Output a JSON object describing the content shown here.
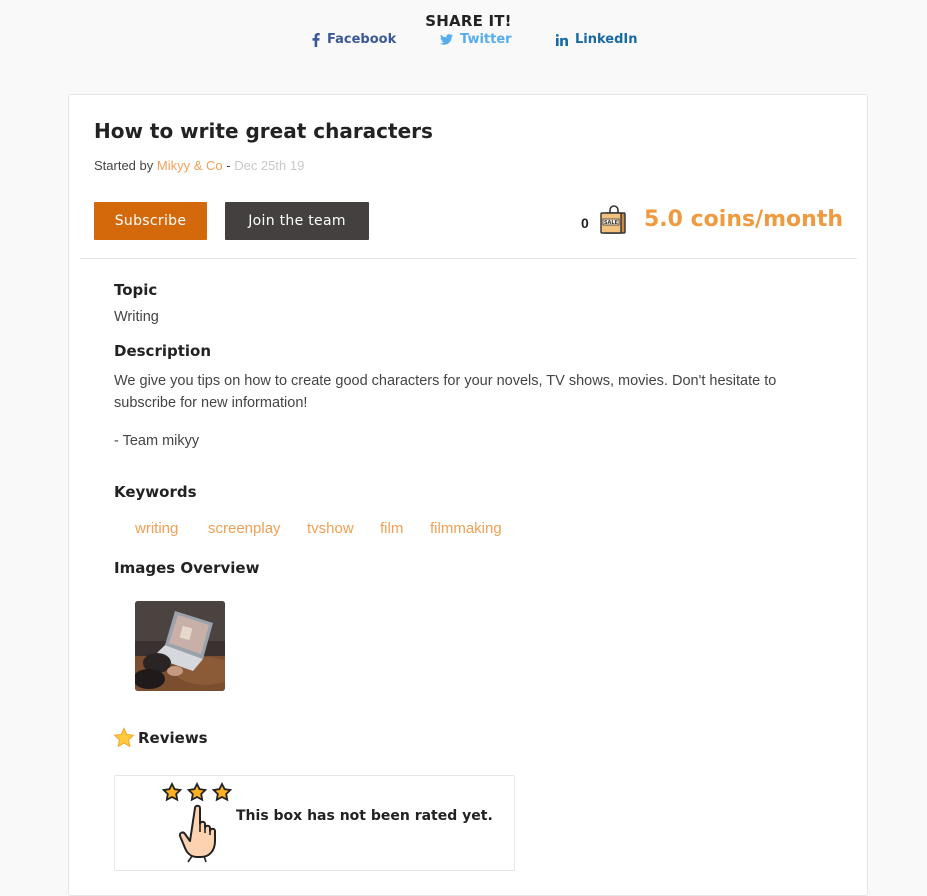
{
  "share": {
    "title": "SHARE IT!",
    "facebook": "Facebook",
    "twitter": "Twitter",
    "linkedin": "LinkedIn"
  },
  "box": {
    "title": "How to write great characters",
    "started_by_label": "Started by",
    "author": "Mikyy & Co",
    "separator": "-",
    "date": "Dec 25th 19",
    "subscribe_label": "Subscribe",
    "join_label": "Join the team",
    "subscriber_count": "0",
    "price": "5.0 coins/month",
    "bag_label": "SALE"
  },
  "topic": {
    "heading": "Topic",
    "value": "Writing"
  },
  "description": {
    "heading": "Description",
    "text": "We give you tips on how to create good characters for your novels, TV shows, movies. Don't hesitate to subscribe for new information!",
    "signature": "- Team mikyy"
  },
  "keywords": {
    "heading": "Keywords",
    "items": [
      "writing",
      "screenplay",
      "tvshow",
      "film",
      "filmmaking"
    ]
  },
  "images": {
    "heading": "Images Overview"
  },
  "reviews": {
    "heading": "Reviews",
    "empty_text": "This box has not been rated yet."
  },
  "colors": {
    "accent_orange": "#d3690a",
    "link_orange": "#f0a055",
    "dark_button": "#444040",
    "facebook": "#3b5998",
    "twitter": "#55acee",
    "linkedin": "#1a6aa2"
  },
  "icons": [
    "facebook-icon",
    "twitter-icon",
    "linkedin-icon",
    "sale-bag-icon",
    "star-icon",
    "rating-stars-icon",
    "pointing-hand-icon"
  ]
}
